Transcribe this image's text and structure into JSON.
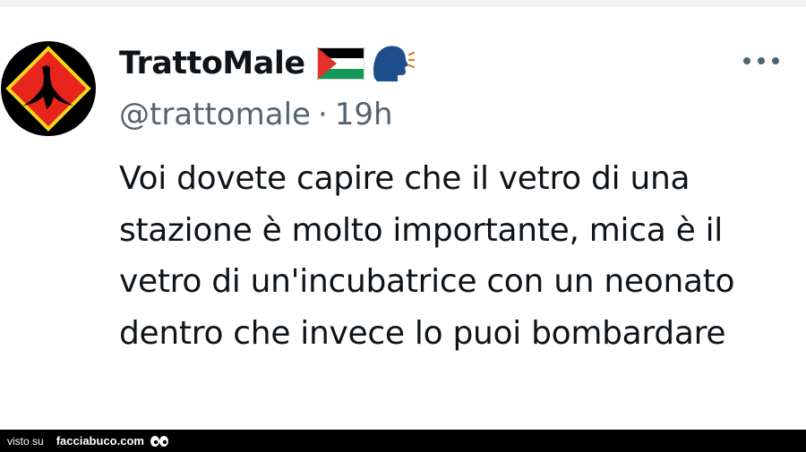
{
  "tweet": {
    "display_name": "TrattoMale",
    "handle": "@trattomale",
    "separator": "·",
    "time": "19h",
    "text": "Voi dovete capire che il vetro di una stazione è molto importante, mica è il vetro di un'incubatrice con un neonato dentro che invece lo puoi bombardare",
    "name_icons": [
      "palestine-flag-icon",
      "speaking-head-icon"
    ],
    "more_icon": "more-dots-icon",
    "avatar_icon": "banana-warning-sign-icon"
  },
  "footer": {
    "visto_label": "visto su",
    "brand": "facciabuco.com",
    "brand_icon": "eyes-icon"
  },
  "colors": {
    "text_primary": "#0f1419",
    "text_secondary": "#536471",
    "footer_bg": "#000000",
    "avatar_red": "#e8251c",
    "avatar_yellow": "#f7d51d"
  }
}
